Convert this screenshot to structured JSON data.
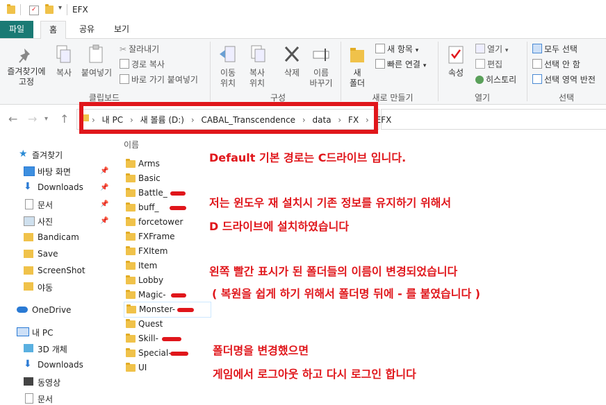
{
  "window": {
    "title": "EFX"
  },
  "menu_tabs": [
    "파일",
    "홈",
    "공유",
    "보기"
  ],
  "ribbon": {
    "clipboard": {
      "pin_label_1": "즐겨찾기에",
      "pin_label_2": "고정",
      "copy": "복사",
      "paste": "붙여넣기",
      "cut": "잘라내기",
      "copy_path": "경로 복사",
      "paste_shortcut": "바로 가기 붙여넣기",
      "group_label": "클립보드"
    },
    "organize": {
      "move_to_1": "이동",
      "move_to_2": "위치",
      "copy_to_1": "복사",
      "copy_to_2": "위치",
      "delete": "삭제",
      "rename_1": "이름",
      "rename_2": "바꾸기",
      "group_label": "구성"
    },
    "new": {
      "new_folder_1": "새",
      "new_folder_2": "폴더",
      "new_item": "새 항목",
      "easy_access": "빠른 연결",
      "group_label": "새로 만들기"
    },
    "open": {
      "properties": "속성",
      "open": "열기",
      "edit": "편집",
      "history": "히스토리",
      "group_label": "열기"
    },
    "select": {
      "select_all": "모두 선택",
      "select_none": "선택 안 함",
      "invert": "선택 영역 반전",
      "group_label": "선택"
    }
  },
  "address": {
    "segments": [
      "내 PC",
      "새 볼륨 (D:)",
      "CABAL_Transcendence",
      "data",
      "FX",
      "EFX"
    ],
    "separator": "›"
  },
  "sidebar": {
    "quick_access": "즐겨찾기",
    "items": [
      "바탕 화면",
      "Downloads",
      "문서",
      "사진",
      "Bandicam",
      "Save",
      "ScreenShot",
      "야동"
    ],
    "onedrive": "OneDrive",
    "this_pc": "내 PC",
    "pc_items": [
      "3D 개체",
      "Downloads",
      "동영상",
      "문서"
    ]
  },
  "list": {
    "column_name": "이름",
    "folders": [
      "Arms",
      "Basic",
      "Battle_",
      "buff_",
      "forcetower",
      "FXFrame",
      "FXItem",
      "Item",
      "Lobby",
      "Magic-",
      "Monster-",
      "Quest",
      "Skill-",
      "Special-",
      "UI"
    ],
    "marked": [
      "Battle_",
      "buff_",
      "Magic-",
      "Monster-",
      "Skill-",
      "Special-"
    ]
  },
  "annotations": {
    "line1": "Default 기본 경로는 C드라이브 입니다.",
    "line2": "저는 윈도우 재 설치시 기존 정보를 유지하기 위해서",
    "line3": "D 드라이브에 설치하였습니다",
    "line4": "왼쪽 빨간 표시가 된 폴더들의 이름이 변경되었습니다",
    "line5": "( 복원을 쉽게 하기 위해서 폴더명 뒤에 - 를 붙였습니다 )",
    "line6": "폴더명을 변경했으면",
    "line7": "게임에서 로그아웃 하고 다시 로그인 합니다"
  },
  "colors": {
    "file_tab": "#1a7a74",
    "annotation_red": "#e0161b",
    "folder_yellow": "#f0c24a"
  }
}
